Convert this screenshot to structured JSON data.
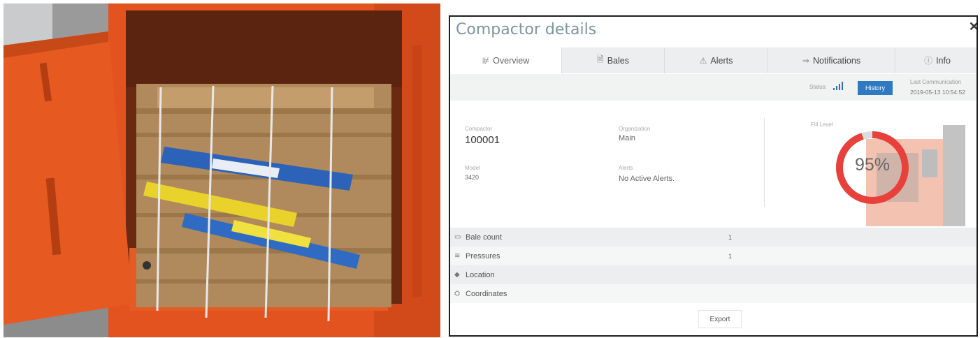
{
  "dialog": {
    "title": "Compactor details",
    "close_icon": "close-icon"
  },
  "tabs": [
    {
      "label": "Overview",
      "icon": "chart-icon",
      "glyph": "⊯",
      "active": true
    },
    {
      "label": "Bales",
      "icon": "document-icon",
      "glyph": "🗎",
      "active": false
    },
    {
      "label": "Alerts",
      "icon": "warning-icon",
      "glyph": "⚠",
      "active": false
    },
    {
      "label": "Notifications",
      "icon": "share-icon",
      "glyph": "⇒",
      "active": false
    },
    {
      "label": "Info",
      "icon": "info-icon",
      "glyph": "ⓘ",
      "active": false
    }
  ],
  "status_bar": {
    "status_label": "Status:",
    "history_label": "History",
    "last_comm_label": "Last Communication",
    "last_comm_value": "2019-05-13 10:54:52"
  },
  "details": {
    "compactor_label": "Compactor",
    "compactor_value": "100001",
    "organization_label": "Organization",
    "organization_value": "Main",
    "model_label": "Model",
    "model_value": "3420",
    "alerts_label": "Alerts",
    "alerts_value": "No Active Alerts."
  },
  "fill": {
    "label": "Fill Level",
    "percent": 95,
    "display": "95%",
    "color": "#e8413c",
    "track_color": "#d8dde0"
  },
  "rows": [
    {
      "label": "Bale count",
      "icon": "bale-icon",
      "glyph": "▭",
      "value": "1"
    },
    {
      "label": "Pressures",
      "icon": "pressure-icon",
      "glyph": "≋",
      "value": "1"
    },
    {
      "label": "Location",
      "icon": "location-icon",
      "glyph": "◆",
      "value": ""
    },
    {
      "label": "Coordinates",
      "icon": "coordinates-icon",
      "glyph": "⛭",
      "value": ""
    }
  ],
  "export_label": "Export",
  "colors": {
    "accent": "#2f79c2",
    "title": "#7d95a1",
    "baler": "#e2531f"
  }
}
